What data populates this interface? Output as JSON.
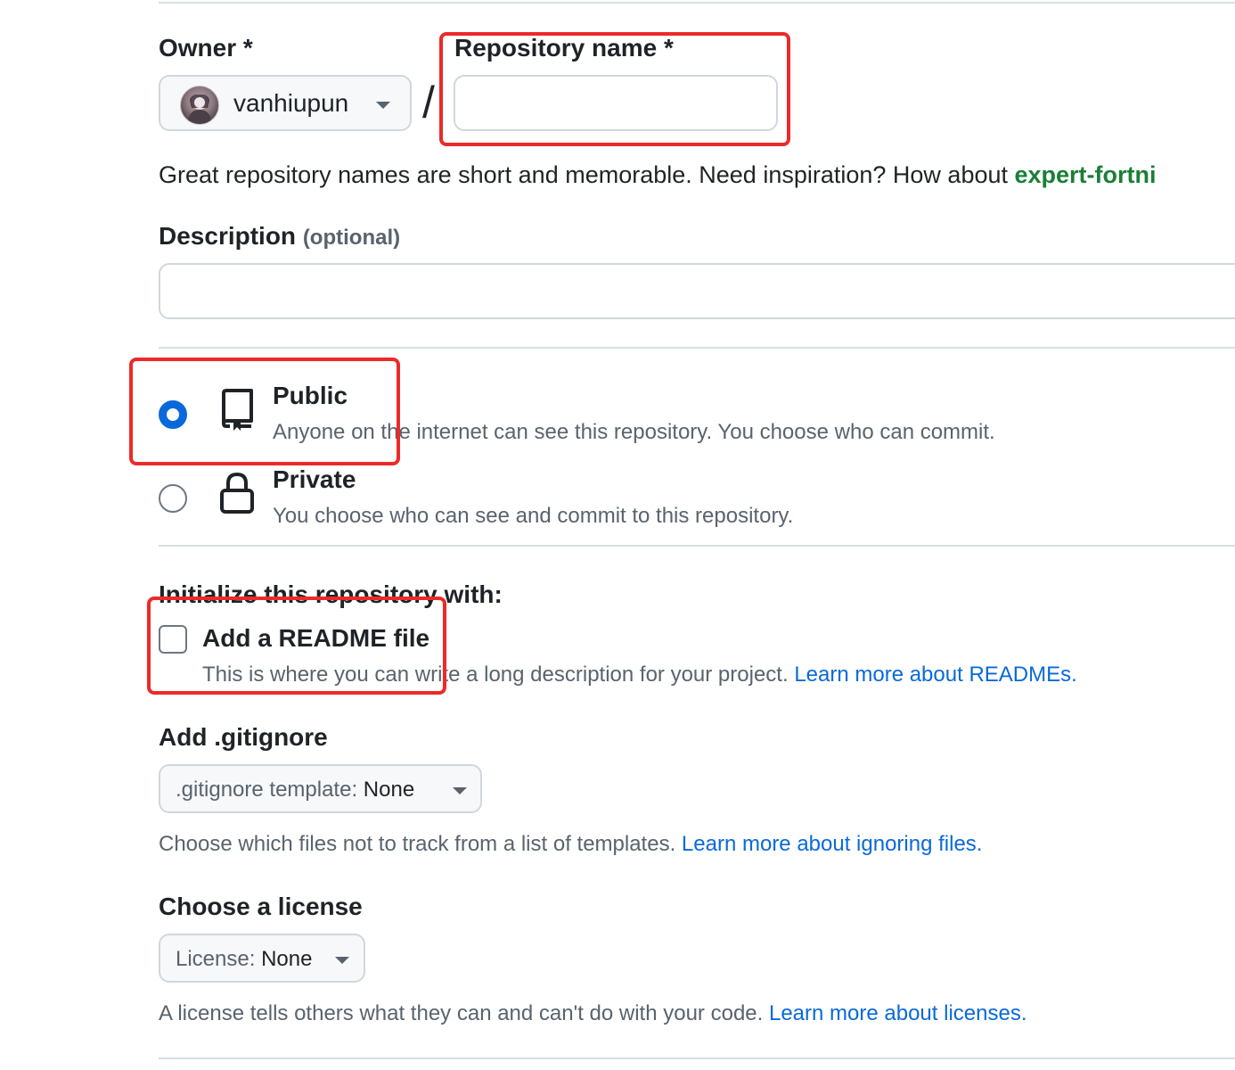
{
  "owner": {
    "label": "Owner *",
    "selected": "vanhiupun"
  },
  "repo_name": {
    "label": "Repository name *",
    "value": "",
    "separator": "/"
  },
  "name_hint": {
    "text": "Great repository names are short and memorable. Need inspiration? How about ",
    "suggestion": "expert-fortni"
  },
  "description": {
    "label": "Description",
    "optional": "(optional)",
    "value": ""
  },
  "visibility": {
    "options": [
      {
        "title": "Public",
        "desc": "Anyone on the internet can see this repository. You choose who can commit.",
        "selected": true,
        "icon": "repo-icon"
      },
      {
        "title": "Private",
        "desc": "You choose who can see and commit to this repository.",
        "selected": false,
        "icon": "lock-icon"
      }
    ]
  },
  "initialize": {
    "heading": "Initialize this repository with:",
    "readme": {
      "title": "Add a README file",
      "desc": "This is where you can write a long description for your project. ",
      "link": "Learn more about READMEs.",
      "checked": false
    }
  },
  "gitignore": {
    "heading": "Add .gitignore",
    "prefix": ".gitignore template: ",
    "value": "None",
    "note": "Choose which files not to track from a list of templates. ",
    "link": "Learn more about ignoring files."
  },
  "license": {
    "heading": "Choose a license",
    "prefix": "License: ",
    "value": "None",
    "note": "A license tells others what they can and can't do with your code. ",
    "link": "Learn more about licenses."
  },
  "colors": {
    "accent": "#0969da",
    "suggestion": "#1a7f37",
    "highlight": "#ec2a2a"
  }
}
